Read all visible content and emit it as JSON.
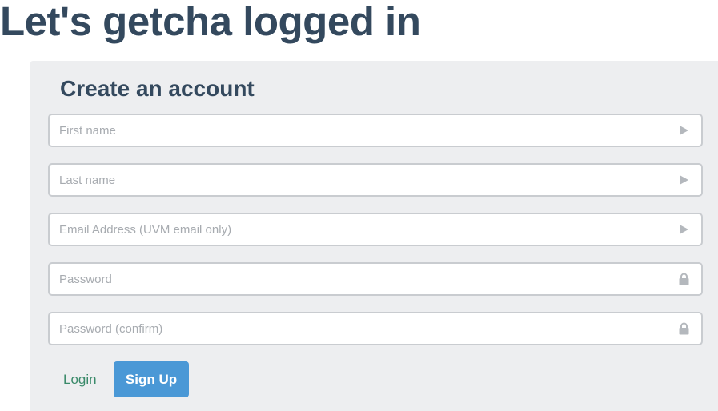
{
  "page": {
    "heading": "Let's getcha logged in"
  },
  "signup_form": {
    "title": "Create an account",
    "fields": [
      {
        "placeholder": "First name",
        "value": "",
        "icon": "play-arrow-icon"
      },
      {
        "placeholder": "Last name",
        "value": "",
        "icon": "play-arrow-icon"
      },
      {
        "placeholder": "Email Address (UVM email only)",
        "value": "",
        "icon": "play-arrow-icon"
      },
      {
        "placeholder": "Password",
        "value": "",
        "icon": "lock-icon"
      },
      {
        "placeholder": "Password (confirm)",
        "value": "",
        "icon": "lock-icon"
      }
    ],
    "login_label": "Login",
    "signup_label": "Sign Up"
  },
  "colors": {
    "heading": "#34495e",
    "panel_background": "#edeef0",
    "field_border": "#c9ccd0",
    "icon": "#b4b8bd",
    "login_link": "#3a8a6a",
    "signup_button": "#4a98d6"
  }
}
